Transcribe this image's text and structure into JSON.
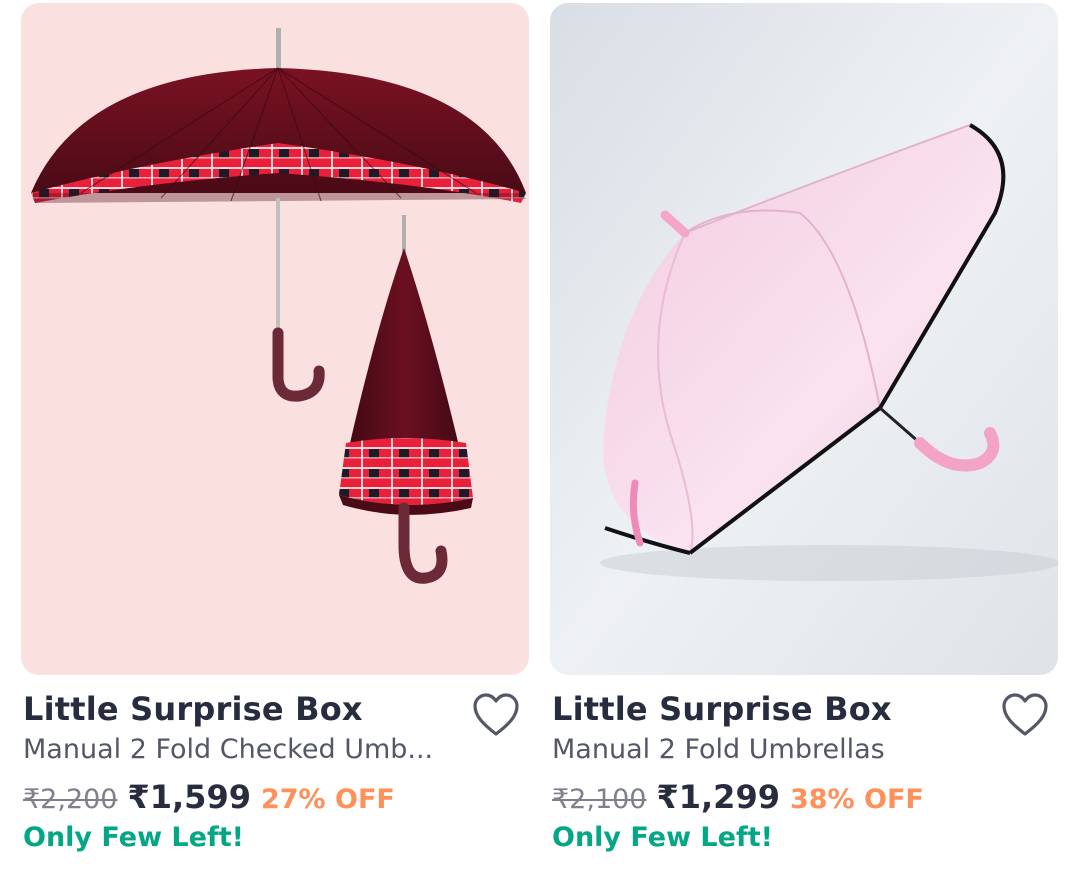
{
  "products": [
    {
      "brand": "Little Surprise Box",
      "name": "Manual 2 Fold Checked Umb...",
      "mrp": "₹2,200",
      "price": "₹1,599",
      "discount": "27% OFF",
      "stock": "Only Few Left!",
      "image_bg": "#fbe0e0",
      "umbrella_color": "#6b1020",
      "check_color": "#e8203a"
    },
    {
      "brand": "Little Surprise Box",
      "name": "Manual 2 Fold Umbrellas",
      "mrp": "₹2,100",
      "price": "₹1,299",
      "discount": "38% OFF",
      "stock": "Only Few Left!",
      "image_bg": "#e6eaef",
      "umbrella_color": "#f7d7e9",
      "check_color": "#111111"
    }
  ],
  "wishlist_icon": "heart-outline-icon"
}
